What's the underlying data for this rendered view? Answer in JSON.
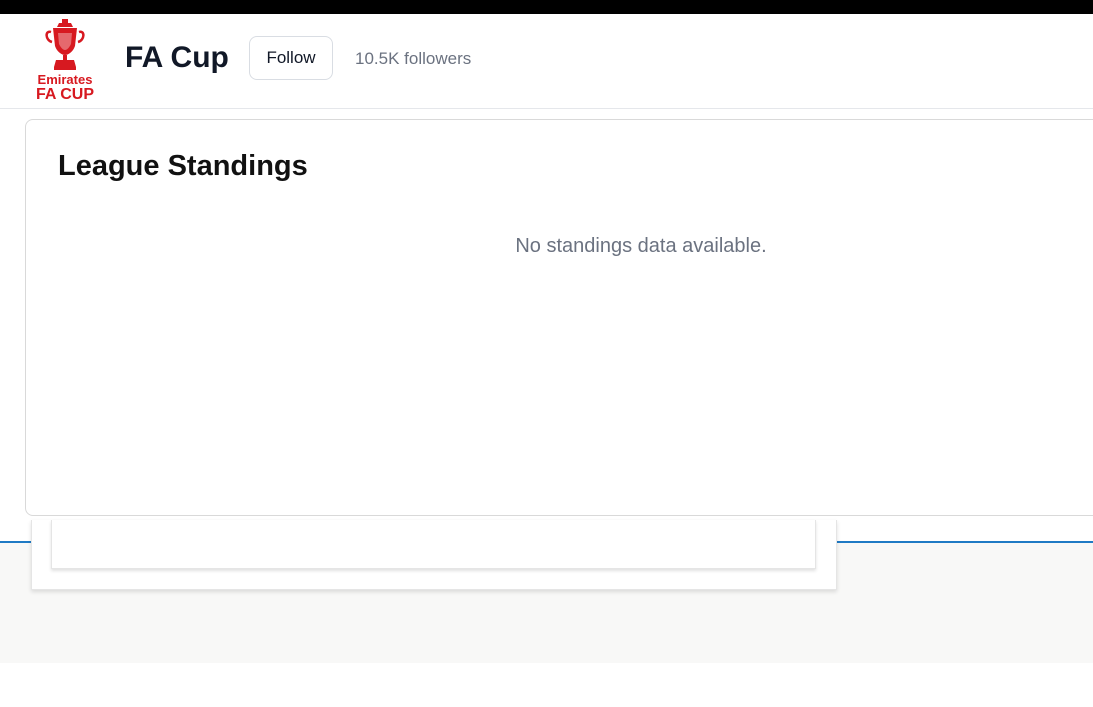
{
  "header": {
    "logo": {
      "icon": "fa-cup-trophy-icon",
      "line1": "Emirates",
      "line2": "FA CUP",
      "color": "#d71920"
    },
    "title": "FA Cup",
    "follow_label": "Follow",
    "followers_text": "10.5K followers"
  },
  "standings": {
    "title": "League Standings",
    "empty_message": "No standings data available."
  },
  "colors": {
    "accent_line": "#1f7ac4",
    "text_muted": "#6b7280",
    "brand_red": "#d71920"
  }
}
